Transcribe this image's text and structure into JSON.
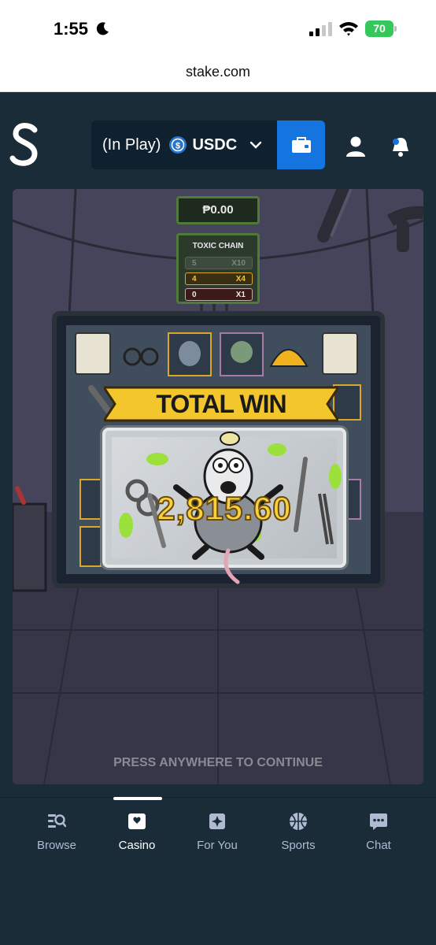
{
  "status_bar": {
    "time": "1:55",
    "battery": "70"
  },
  "browser": {
    "url": "stake.com"
  },
  "header": {
    "wallet_status": "(In Play)",
    "currency": "USDC"
  },
  "game": {
    "balance": "₱0.00",
    "toxic_chain": {
      "title": "TOXIC CHAIN",
      "rows": [
        {
          "level": "5",
          "multiplier": "X10"
        },
        {
          "level": "4",
          "multiplier": "X4"
        },
        {
          "level": "0",
          "multiplier": "X1"
        }
      ]
    },
    "total_win_label": "TOTAL WIN",
    "win_amount": "2,815.60",
    "continue_text": "PRESS ANYWHERE TO CONTINUE"
  },
  "nav": {
    "items": [
      {
        "label": "Browse",
        "icon": "browse-icon"
      },
      {
        "label": "Casino",
        "icon": "casino-icon"
      },
      {
        "label": "For You",
        "icon": "for-you-icon"
      },
      {
        "label": "Sports",
        "icon": "sports-icon"
      },
      {
        "label": "Chat",
        "icon": "chat-icon"
      }
    ],
    "active": "Casino"
  },
  "colors": {
    "accent": "#1475e1",
    "background": "#1a2c38",
    "battery": "#34c759",
    "win_gold": "#f7d23a"
  }
}
